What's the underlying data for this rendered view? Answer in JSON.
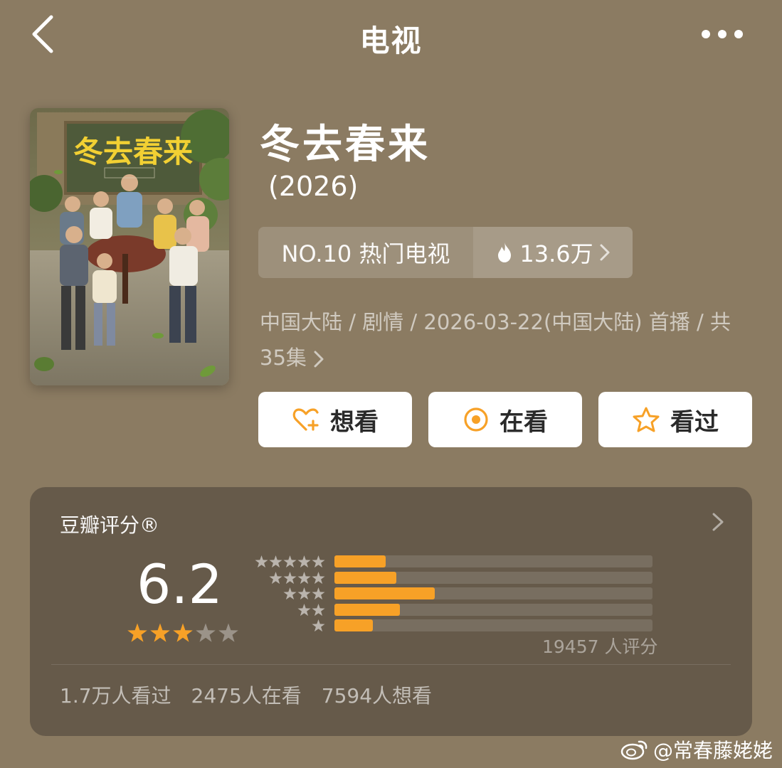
{
  "header": {
    "title": "电视",
    "back_icon": "chevron-left-icon",
    "more_icon": "more-dots-icon"
  },
  "movie": {
    "title": "冬去春来",
    "year": "(2026)",
    "poster_title": "冬去春来",
    "rank_label": "NO.10 热门电视",
    "heat_value": "13.6万",
    "meta": "中国大陆 / 剧情 / 2026-03-22(中国大陆) 首播 / 共",
    "episodes": "35集"
  },
  "actions": [
    {
      "label": "想看",
      "icon": "heart-plus-icon"
    },
    {
      "label": "在看",
      "icon": "target-circle-icon"
    },
    {
      "label": "看过",
      "icon": "star-outline-icon"
    }
  ],
  "rating": {
    "label": "豆瓣评分®",
    "score": "6.2",
    "stars_filled": 3,
    "stars_total": 5,
    "distribution": [
      {
        "stars": 5,
        "fraction": 0.16
      },
      {
        "stars": 4,
        "fraction": 0.195
      },
      {
        "stars": 3,
        "fraction": 0.315
      },
      {
        "stars": 2,
        "fraction": 0.205
      },
      {
        "stars": 1,
        "fraction": 0.12
      }
    ],
    "count_text": "19457 人评分"
  },
  "stats": {
    "watched": "1.7万人看过",
    "watching": "2475人在看",
    "want": "7594人想看"
  },
  "watermark": "@常春藤姥姥",
  "colors": {
    "background": "#8b7b62",
    "card": "#665a4a",
    "accent_orange": "#f7a127",
    "button_bg": "#ffffff"
  }
}
